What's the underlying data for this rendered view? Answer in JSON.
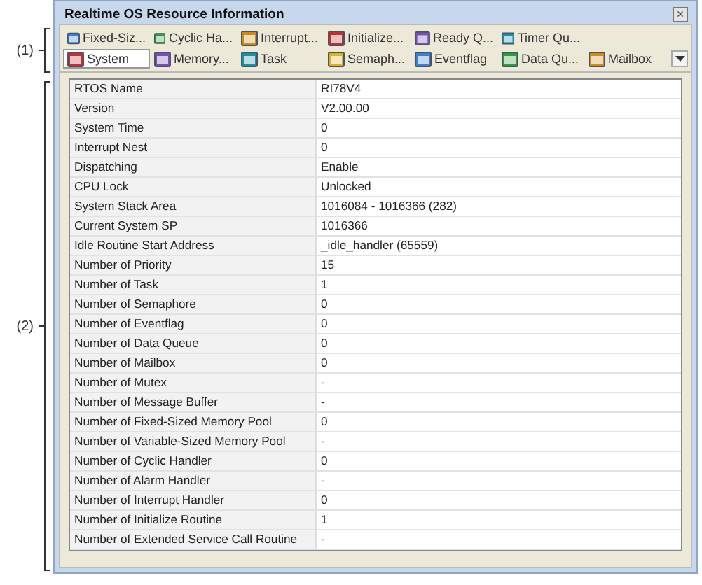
{
  "annotations": [
    {
      "label": "(1)"
    },
    {
      "label": "(2)"
    }
  ],
  "window": {
    "title": "Realtime OS Resource Information",
    "close": "×"
  },
  "tabs": [
    [
      {
        "label": "Fixed-Siz...",
        "selected": false
      },
      {
        "label": "Cyclic Ha...",
        "selected": false
      },
      {
        "label": "Interrupt...",
        "selected": false
      },
      {
        "label": "Initialize...",
        "selected": false
      },
      {
        "label": "Ready Q...",
        "selected": false
      },
      {
        "label": "Timer Qu...",
        "selected": false
      }
    ],
    [
      {
        "label": "System",
        "selected": true
      },
      {
        "label": "Memory...",
        "selected": false
      },
      {
        "label": "Task",
        "selected": false
      },
      {
        "label": "Semaph...",
        "selected": false
      },
      {
        "label": "Eventflag",
        "selected": false
      },
      {
        "label": "Data Qu...",
        "selected": false
      },
      {
        "label": "Mailbox",
        "selected": false
      }
    ]
  ],
  "table": {
    "rows": [
      [
        "RTOS Name",
        "RI78V4"
      ],
      [
        "Version",
        "V2.00.00"
      ],
      [
        "System Time",
        "0"
      ],
      [
        "Interrupt Nest",
        "0"
      ],
      [
        "Dispatching",
        "Enable"
      ],
      [
        "CPU Lock",
        "Unlocked"
      ],
      [
        "System Stack Area",
        "1016084 - 1016366 (282)"
      ],
      [
        "Current System SP",
        "1016366"
      ],
      [
        "Idle Routine Start Address",
        "_idle_handler (65559)"
      ],
      [
        "Number of Priority",
        "15"
      ],
      [
        "Number of Task",
        "1"
      ],
      [
        "Number of Semaphore",
        "0"
      ],
      [
        "Number of Eventflag",
        "0"
      ],
      [
        "Number of Data Queue",
        "0"
      ],
      [
        "Number of Mailbox",
        "0"
      ],
      [
        "Number of Mutex",
        "-"
      ],
      [
        "Number of Message Buffer",
        "-"
      ],
      [
        "Number of Fixed-Sized Memory Pool",
        "0"
      ],
      [
        "Number of Variable-Sized Memory Pool",
        "-"
      ],
      [
        "Number of Cyclic Handler",
        "0"
      ],
      [
        "Number of Alarm Handler",
        "-"
      ],
      [
        "Number of Interrupt Handler",
        "0"
      ],
      [
        "Number of Initialize Routine",
        "1"
      ],
      [
        "Number of Extended Service Call Routine",
        "-"
      ]
    ]
  }
}
